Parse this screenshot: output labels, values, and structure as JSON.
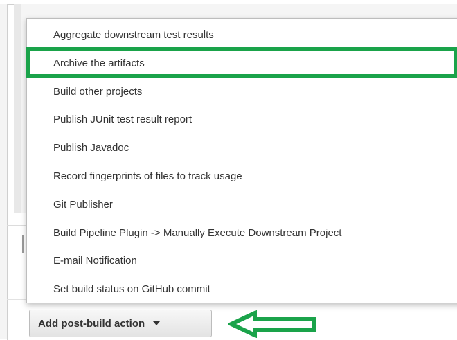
{
  "menu": {
    "items": [
      {
        "label": "Aggregate downstream test results"
      },
      {
        "label": "Archive the artifacts"
      },
      {
        "label": "Build other projects"
      },
      {
        "label": "Publish JUnit test result report"
      },
      {
        "label": "Publish Javadoc"
      },
      {
        "label": "Record fingerprints of files to track usage"
      },
      {
        "label": "Git Publisher"
      },
      {
        "label": "Build Pipeline Plugin -> Manually Execute Downstream Project"
      },
      {
        "label": "E-mail Notification"
      },
      {
        "label": "Set build status on GitHub commit"
      }
    ],
    "highlighted_index": 1
  },
  "add_action_button": {
    "label": "Add post-build action"
  },
  "annotation": {
    "arrow_color": "#1aa34a",
    "highlight_color": "#1aa34a",
    "arrow_direction": "left"
  }
}
